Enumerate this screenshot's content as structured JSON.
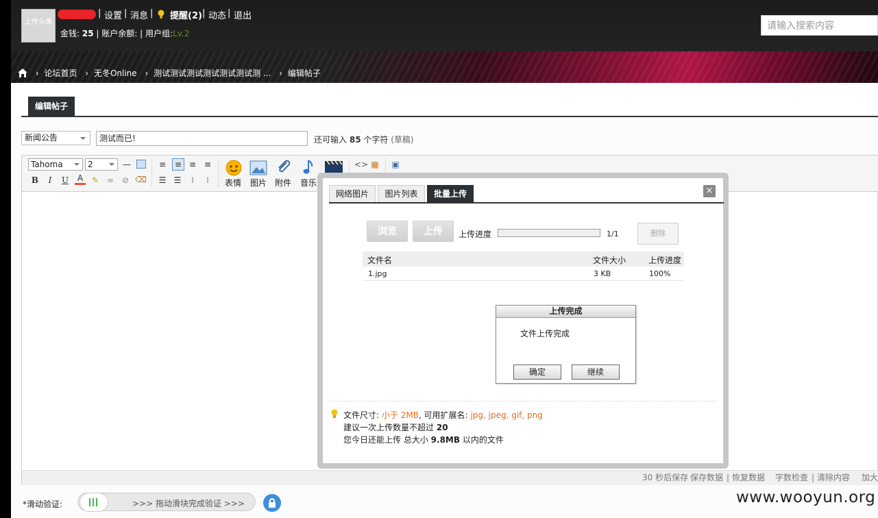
{
  "header": {
    "avatar_text": "上传头像",
    "links": [
      "设置",
      "消息",
      "提醒(2)",
      "动态",
      "退出"
    ],
    "separator": "|",
    "line2": {
      "gold_label": "金钱:",
      "gold_value": "25",
      "balance_label": "账户余额:",
      "group_label": "用户组:",
      "group_value": "Lv.2"
    },
    "search_placeholder": "请输入搜索内容"
  },
  "breadcrumb": [
    "论坛首页",
    "无冬Online",
    "测试测试测试测试测试测试测 ...",
    "编辑帖子"
  ],
  "page_tab": "编辑帖子",
  "form": {
    "category": "新闻公告",
    "title": "测试而已!",
    "remain_prefix": "还可输入",
    "remain_count": "85",
    "remain_suffix": "个字符",
    "draft": "(草稿)"
  },
  "toolbar": {
    "font": "Tahoma",
    "size": "2",
    "buttons": [
      "表情",
      "图片",
      "附件",
      "音乐"
    ]
  },
  "status_bar": {
    "autosave": "30 秒后保存",
    "save": "保存数据",
    "restore": "恢复数据",
    "check": "字数检查",
    "clear": "清除内容",
    "enlarge": "加大"
  },
  "verify": {
    "label": "*滑动验证:",
    "slider_text": ">>> 拖动滑块完成验证 >>>"
  },
  "watermark": "www.wooyun.org",
  "dialog": {
    "tabs": [
      "网络图片",
      "图片列表",
      "批量上传"
    ],
    "active_tab": 2,
    "close": "×",
    "browse": "浏览",
    "upload": "上传",
    "progress_label": "上传进度",
    "progress_count": "1/1",
    "delete": "删除",
    "table": {
      "headers": [
        "文件名",
        "文件大小",
        "上传进度"
      ],
      "rows": [
        [
          "1.jpg",
          "3 KB",
          "100%"
        ]
      ]
    },
    "alert": {
      "title": "上传完成",
      "message": "文件上传完成",
      "ok": "确定",
      "continue": "继续"
    },
    "hints": {
      "size_label": "文件尺寸:",
      "size_value": "小于 2MB",
      "ext_label": ", 可用扩展名:",
      "ext_value": "jpg, jpeg, gif, png",
      "line2_prefix": "建议一次上传数量不超过",
      "line2_value": "20",
      "line3_prefix": "您今日还能上传 总大小",
      "line3_value": "9.8MB",
      "line3_suffix": "以内的文件"
    }
  },
  "colors": {
    "accent_dark": "#2b3034",
    "hint_orange": "#e56b1f",
    "redaction": "#e8232a"
  }
}
